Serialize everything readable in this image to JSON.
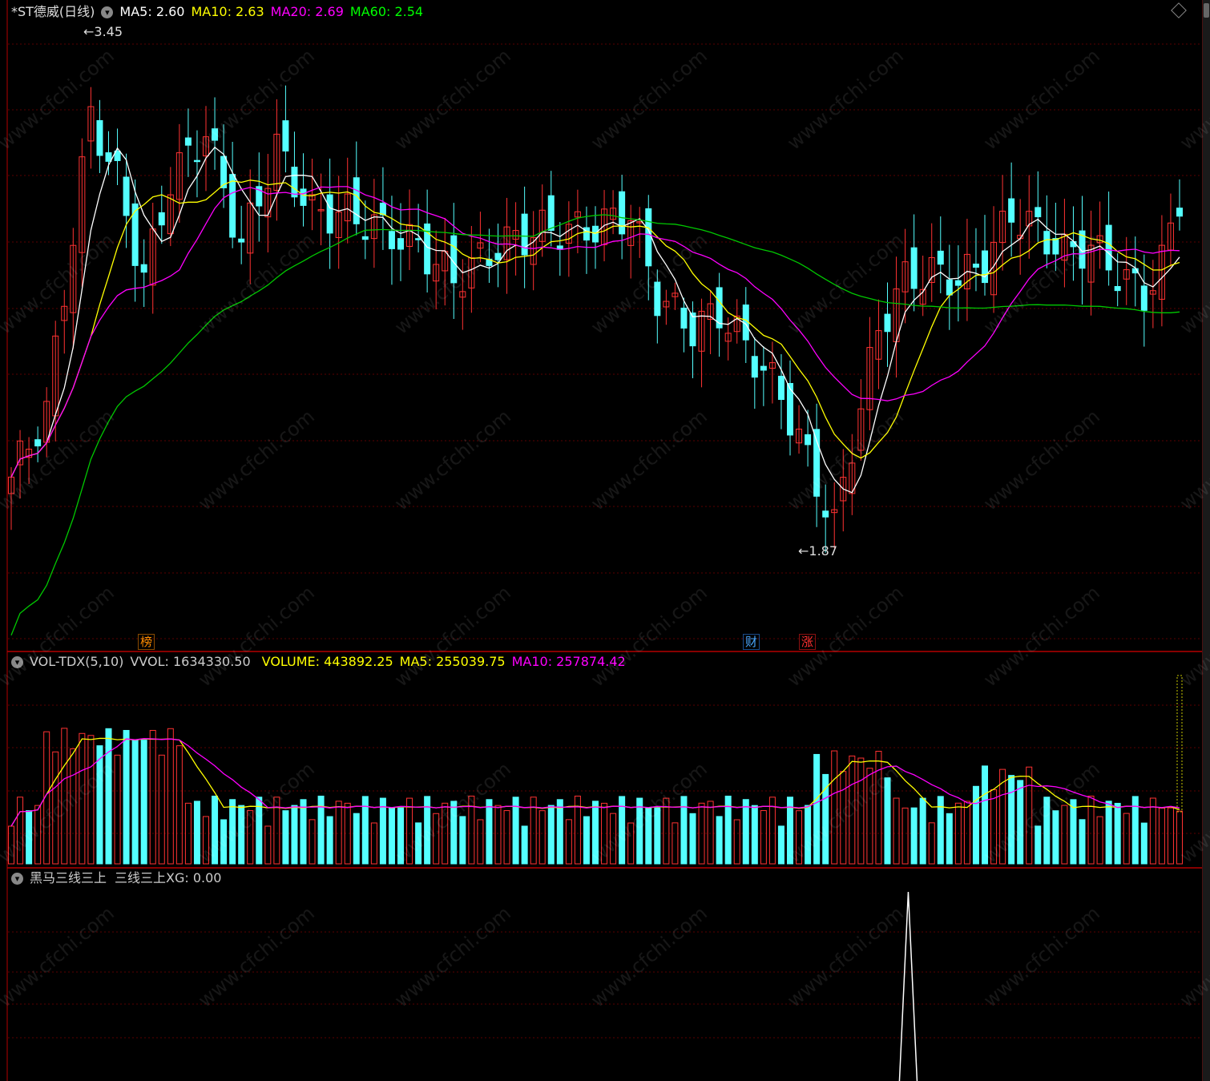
{
  "main_panel": {
    "title": "*ST德威(日线)",
    "indicators": [
      {
        "label": "MA5: 2.60",
        "color": "#ffffff"
      },
      {
        "label": "MA10: 2.63",
        "color": "#ffff00"
      },
      {
        "label": "MA20: 2.69",
        "color": "#ff00ff"
      },
      {
        "label": "MA60: 2.54",
        "color": "#00ff00"
      }
    ],
    "high_marker": "3.45",
    "low_marker": "1.87",
    "event_tags": [
      {
        "label": "榜",
        "color": "#ff8c00"
      },
      {
        "label": "财",
        "color": "#4aa8ff"
      },
      {
        "label": "涨",
        "color": "#ff3030"
      }
    ]
  },
  "volume_panel": {
    "title": "VOL-TDX(5,10)",
    "indicators": [
      {
        "label": "VVOL: 1634330.50",
        "color": "#cccccc"
      },
      {
        "label": "VOLUME: 443892.25",
        "color": "#ffff00"
      },
      {
        "label": "MA5: 255039.75",
        "color": "#ffff00"
      },
      {
        "label": "MA10: 257874.42",
        "color": "#ff00ff"
      }
    ]
  },
  "signal_panel": {
    "title": "黑马三线三上",
    "indicators": [
      {
        "label": "三线三上XG: 0.00",
        "color": "#cccccc"
      }
    ]
  },
  "watermark_text": "www.cfchi.com",
  "colors": {
    "up": "#ff3232",
    "down": "#54ffff",
    "ma5": "#ffffff",
    "ma10": "#ffff00",
    "ma20": "#ff00ff",
    "ma60": "#00c800",
    "grid": "#5a0000",
    "panel_border": "#b40000"
  },
  "chart_data": {
    "type": "candlestick",
    "price_high": 3.45,
    "price_low": 1.87,
    "last_ma": {
      "ma5": 2.6,
      "ma10": 2.63,
      "ma20": 2.69,
      "ma60": 2.54
    },
    "signal_series": {
      "name": "三线三上XG",
      "last_value": 0.0,
      "spike_at_bar_fraction": 0.77
    }
  }
}
